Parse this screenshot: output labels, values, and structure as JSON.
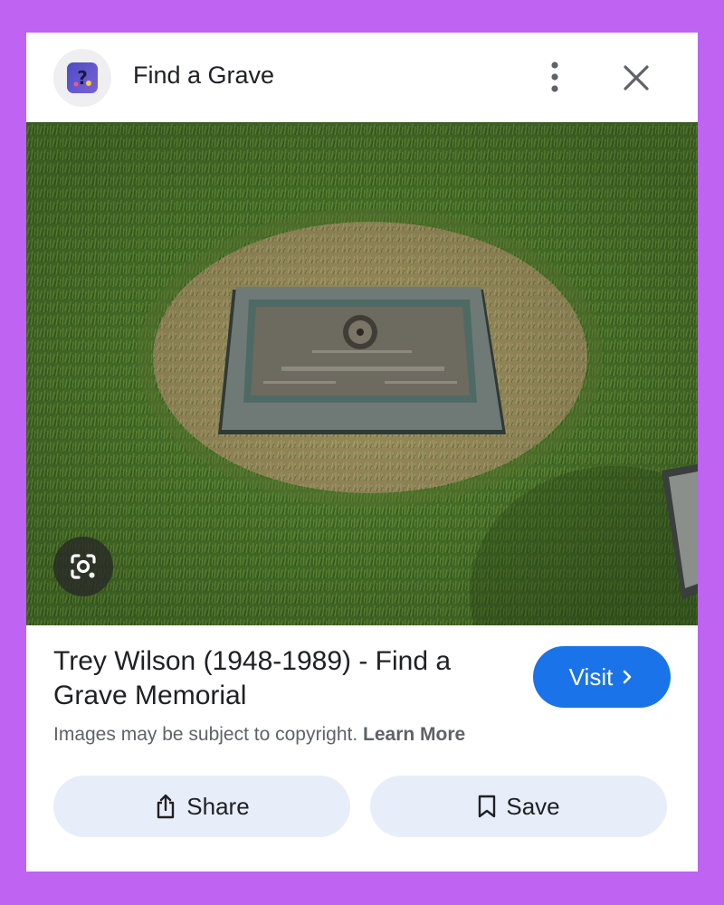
{
  "header": {
    "site_name": "Find a Grave",
    "site_icon": "find-a-grave-logo",
    "more_icon": "more-vertical-icon",
    "close_icon": "close-icon"
  },
  "image": {
    "lens_icon": "google-lens-icon"
  },
  "result": {
    "title": "Trey Wilson (1948-1989) - Find a Grave Memorial",
    "visit_label": "Visit",
    "copyright_text": "Images may be subject to copyright.",
    "learn_more_label": "Learn More"
  },
  "actions": {
    "share_label": "Share",
    "save_label": "Save"
  },
  "colors": {
    "background": "#bf63f3",
    "accent": "#1a73e8",
    "pill": "#e8eef9"
  }
}
